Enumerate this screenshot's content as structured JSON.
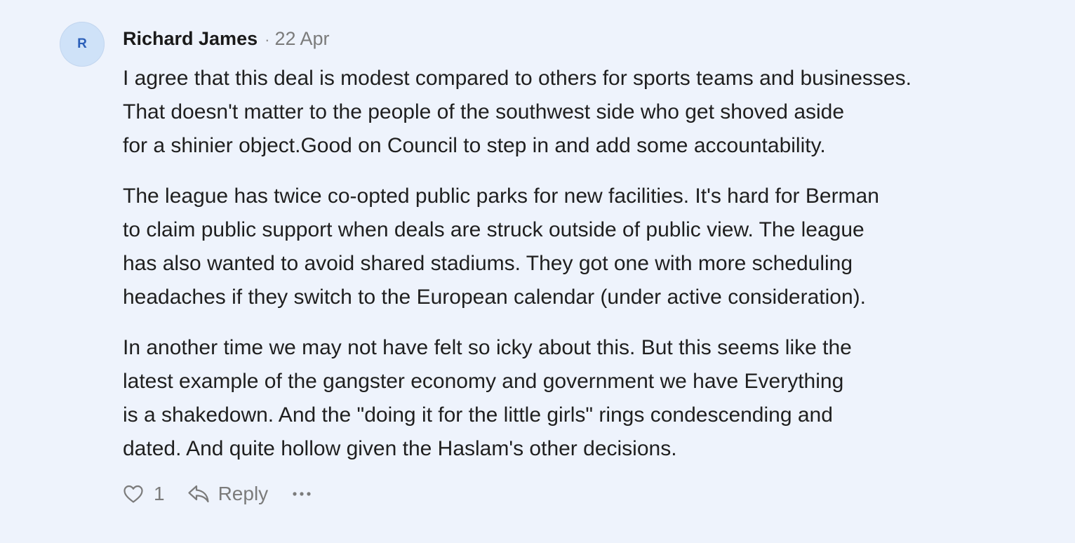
{
  "comment": {
    "avatar_initial": "R",
    "author": "Richard James",
    "separator": "·",
    "date": "22 Apr",
    "paragraphs": [
      {
        "lines": [
          "I agree that this deal is modest compared to others for sports teams and businesses.",
          "That doesn't matter to the people of the southwest side who get shoved aside",
          "for a shinier object.Good on Council to step in and add some accountability."
        ]
      },
      {
        "lines": [
          "The league has twice co-opted public parks for new facilities. It's hard for Berman",
          "to claim public support when deals are struck outside of public view. The league",
          "has also wanted to avoid shared stadiums. They got one with more scheduling",
          "headaches if they switch to the European calendar (under active consideration)."
        ]
      },
      {
        "lines": [
          "In another time we may not have felt so icky about this. But this seems like the",
          "latest example of the gangster economy and government we have Everything",
          "is a shakedown. And the \"doing it for the little girls\" rings condescending and",
          "dated. And quite hollow given the Haslam's other decisions."
        ]
      }
    ],
    "actions": {
      "like_icon": "heart-icon",
      "like_count": "1",
      "reply_icon": "reply-arrow-icon",
      "reply_label": "Reply",
      "more_icon": "ellipsis-icon"
    }
  },
  "colors": {
    "background": "#eef3fc",
    "avatar_bg": "#cfe2f8",
    "avatar_text": "#2b5fb8",
    "text": "#1f1f1f",
    "muted": "#7b7b7b"
  }
}
